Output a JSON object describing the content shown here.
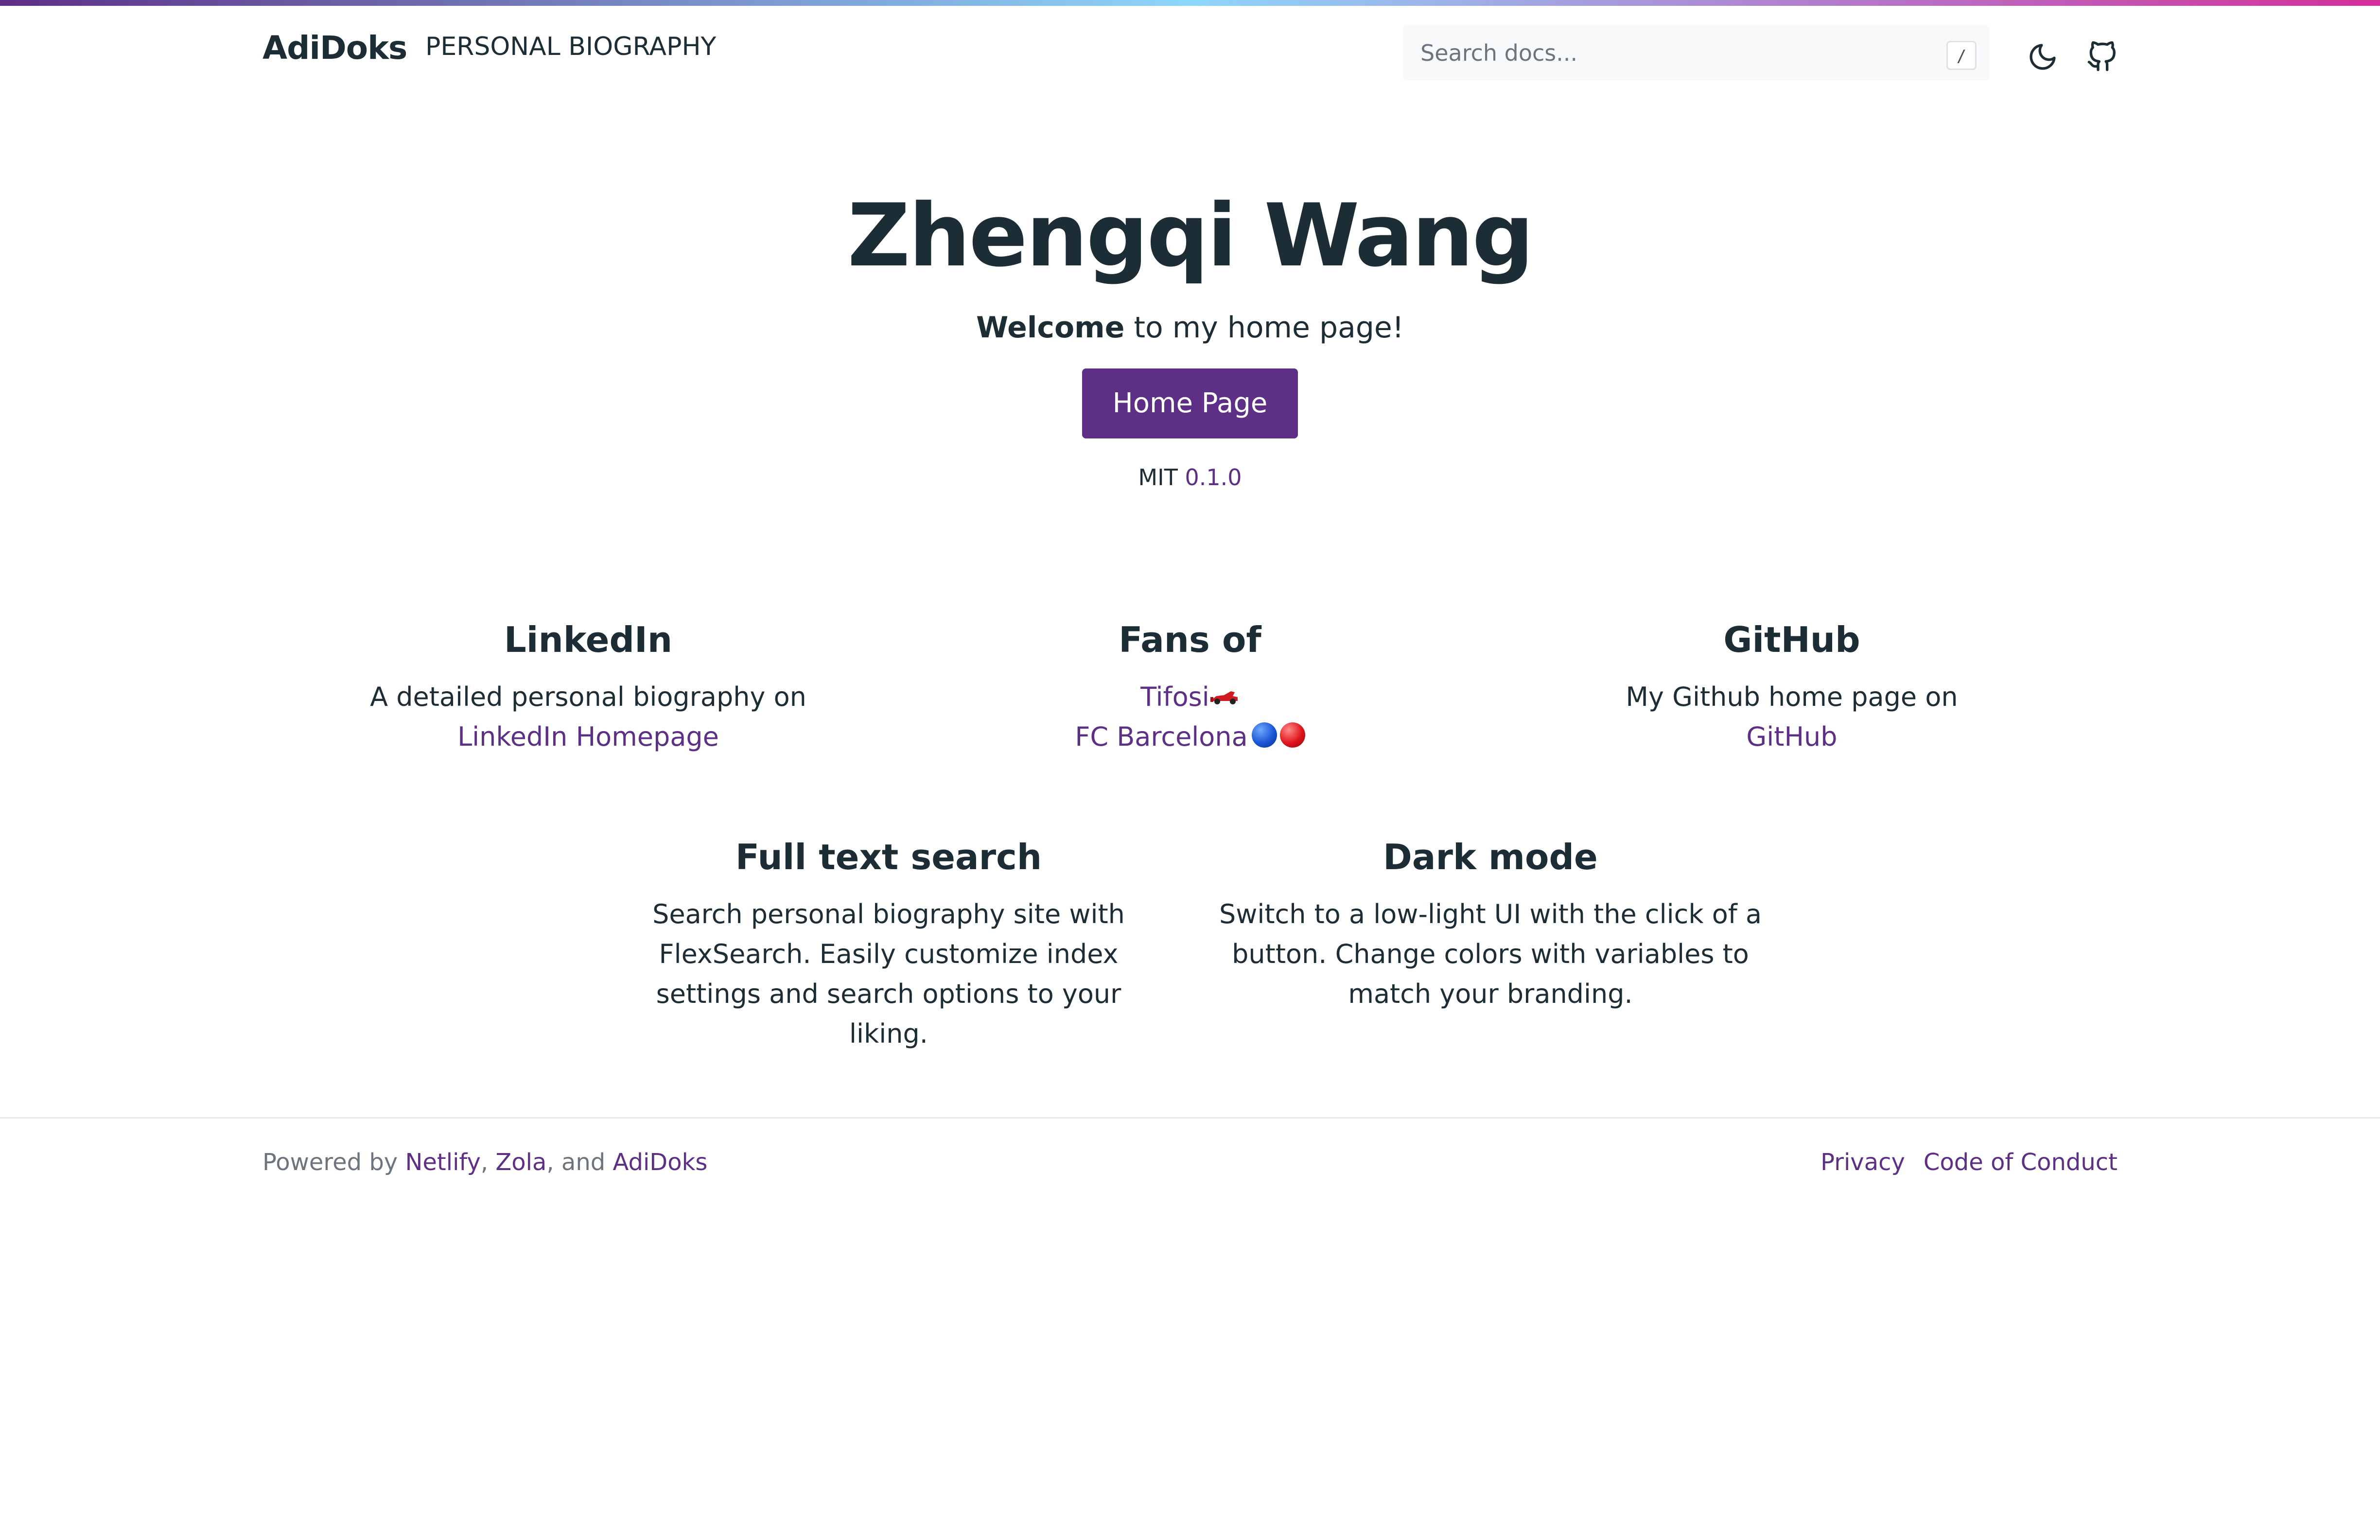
{
  "colors": {
    "accent": "#5d2f86",
    "text": "#1d2d35",
    "muted": "#6c757d",
    "gradient": [
      "#5d2f86",
      "#8ed6fb",
      "#d32e9d"
    ]
  },
  "navbar": {
    "brand": "AdiDoks",
    "link": "PERSONAL BIOGRAPHY",
    "search_placeholder": "Search docs...",
    "search_shortcut": "/",
    "icons": [
      "moon-icon",
      "github-icon"
    ]
  },
  "hero": {
    "title": "Zhengqi Wang",
    "lead_bold": "Welcome",
    "lead_rest": " to my home page!",
    "button": "Home Page",
    "license": "MIT",
    "version": "0.1.0"
  },
  "features": {
    "linkedin": {
      "title": "LinkedIn",
      "text": "A detailed personal biography on",
      "link": "LinkedIn Homepage"
    },
    "fans": {
      "title": "Fans of",
      "link1": "Tifosi",
      "link2": "FC Barcelona",
      "emoji1": "race-car-icon",
      "emoji2": [
        "blue-circle-icon",
        "red-circle-icon"
      ]
    },
    "github": {
      "title": "GitHub",
      "text": "My Github home page on",
      "link": "GitHub"
    },
    "search": {
      "title": "Full text search",
      "text": "Search personal biography site with FlexSearch. Easily customize index settings and search options to your liking."
    },
    "dark": {
      "title": "Dark mode",
      "text": "Switch to a low-light UI with the click of a button. Change colors with variables to match your branding."
    }
  },
  "footer": {
    "powered_by": "Powered by",
    "netlify": "Netlify",
    "sep1": ",",
    "zola": "Zola",
    "sep2": ", and",
    "adidoks": "AdiDoks",
    "privacy": "Privacy",
    "coc": "Code of Conduct"
  }
}
